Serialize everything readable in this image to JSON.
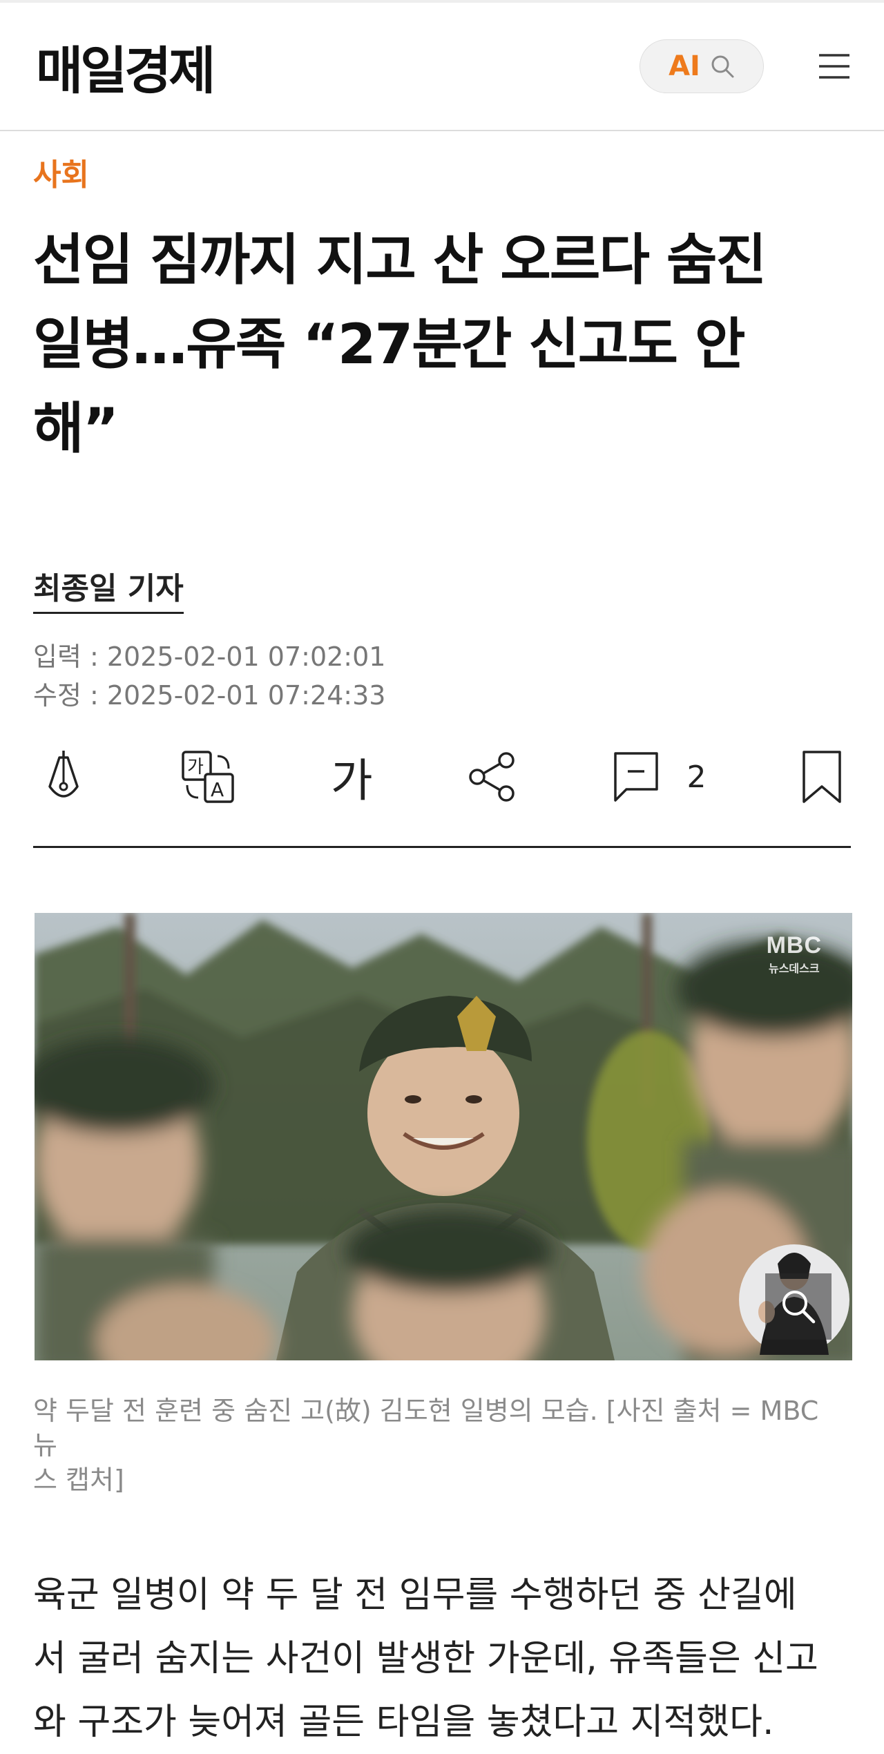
{
  "header": {
    "logo": "매일경제",
    "ai_label": "AI",
    "icons": {
      "search": "search-icon",
      "menu": "hamburger-menu-icon"
    }
  },
  "article": {
    "section": "사회",
    "headline_lines": [
      "선임 짐까지 지고 산 오르다 숨진",
      "일병…유족 “27분간 신고도 안",
      "해”"
    ],
    "reporter": "최종일 기자",
    "input_date": "입력 : 2025-02-01 07:02:01",
    "updated_date": "수정 : 2025-02-01 07:24:33"
  },
  "toolbar": {
    "font_size_label": "가",
    "comment_count": "2",
    "icons": [
      "pen-icon",
      "translate-icon",
      "font-size-icon",
      "share-icon",
      "comment-icon",
      "bookmark-icon"
    ]
  },
  "photo": {
    "watermark_line1": "MBC",
    "watermark_line2": "뉴스데스크",
    "caption_lines": [
      "약 두달 전 훈련 중 숨진 고(故) 김도현 일병의 모습. [사진 출처 = MBC 뉴",
      "스 캡처]"
    ]
  },
  "body": {
    "lines": [
      "육군 일병이 약 두 달 전 임무를 수행하던 중 산길에",
      "서 굴러 숨지는 사건이 발생한 가운데, 유족들은 신고",
      "와 구조가 늦어져 골든 타임을 놓쳤다고 지적했다."
    ]
  },
  "colors": {
    "accent": "#e8741d",
    "text": "#111111",
    "muted": "#777777"
  }
}
